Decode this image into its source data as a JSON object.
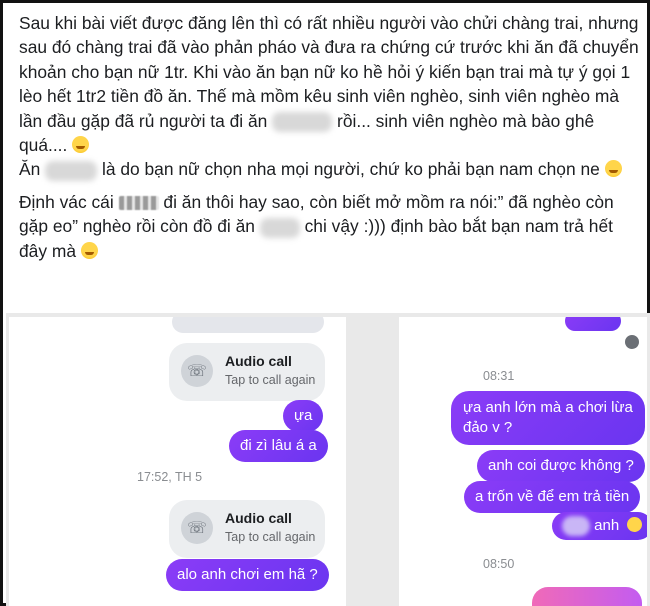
{
  "post": {
    "paragraph1": "Sau khi bài viết được đăng lên thì có rất nhiều người vào chửi chàng trai, nhưng sau đó chàng trai đã vào phản pháo và đưa ra chứng cứ trước khi ăn đã chuyển khoản cho bạn nữ 1tr. Khi vào ăn bạn nữ ko hề hỏi ý kiến bạn trai mà tự ý gọi 1 lèo hết 1tr2 tiền đồ ăn. Thế mà mồm kêu sinh viên nghèo, sinh viên nghèo mà lần đầu gặp đã rủ người ta đi ăn",
    "paragraph1_tail": "rồi... sinh viên nghèo mà bào ghê quá....",
    "paragraph2_head": "Ăn",
    "paragraph2_tail": "là do bạn nữ chọn nha mọi người, chứ ko phải bạn nam chọn ne",
    "paragraph3_head": "Định vác cái",
    "paragraph3_mid": "đi ăn thôi hay sao, còn biết mở mồm ra nói:” đã nghèo còn gặp eo” nghèo rồi còn đồ đi ăn",
    "paragraph3_tail": "chi vậy :))) định bào bắt bạn nam trả hết đây mà"
  },
  "left_chat": {
    "call1": {
      "title": "Audio call",
      "subtitle": "Tap to call again"
    },
    "msg_ua": "ựa",
    "msg_di_zi": "đi zì lâu á a",
    "timestamp": "17:52, TH 5",
    "call2": {
      "title": "Audio call",
      "subtitle": "Tap to call again"
    },
    "msg_alo": "alo anh chơi em hã ?"
  },
  "right_chat": {
    "timestamp1": "08:31",
    "msg1": "ựa anh lớn mà a chơi lừa\nđảo v ?",
    "msg2": "anh coi được không ?",
    "msg3": "a trốn về để em trả tiền",
    "msg4_text": "anh",
    "timestamp2": "08:50"
  },
  "icons": {
    "phone": "phone-icon",
    "emoji": "smiley-emoji-icon"
  },
  "colors": {
    "accent": "#7c3aed",
    "grey_bubble": "#e4e6eb"
  }
}
